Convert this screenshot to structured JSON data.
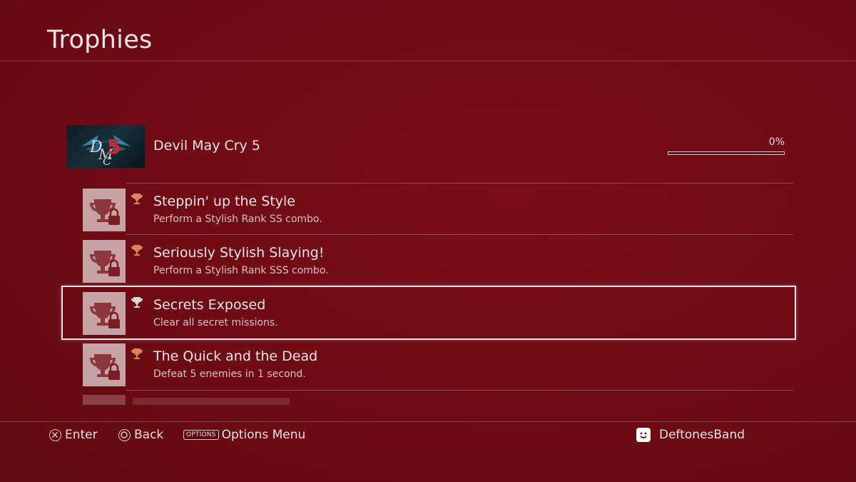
{
  "header": {
    "title": "Trophies"
  },
  "game": {
    "title": "Devil May Cry 5",
    "progress_label": "0%",
    "progress_fraction": 0.0
  },
  "trophies": [
    {
      "name": "Steppin' up the Style",
      "description": "Perform a Stylish Rank SS combo.",
      "grade": "bronze",
      "locked": true
    },
    {
      "name": "Seriously Stylish Slaying!",
      "description": "Perform a Stylish Rank SSS combo.",
      "grade": "bronze",
      "locked": true
    },
    {
      "name": "Secrets Exposed",
      "description": "Clear all secret missions.",
      "grade": "silver",
      "locked": true,
      "selected": true
    },
    {
      "name": "The Quick and the Dead",
      "description": "Defeat 5 enemies in 1 second.",
      "grade": "bronze",
      "locked": true
    }
  ],
  "footer": {
    "enter_label": "Enter",
    "back_label": "Back",
    "options_badge": "OPTIONS",
    "options_label": "Options Menu",
    "username": "DeftonesBand"
  },
  "colors": {
    "background": "#6e0b14",
    "bronze": "#d6875a",
    "silver": "#d8d8d8"
  },
  "icons": {
    "cross": "cross-button-icon",
    "circle": "circle-button-icon",
    "user": "user-avatar-icon",
    "lock": "lock-icon",
    "trophy": "trophy-icon"
  }
}
